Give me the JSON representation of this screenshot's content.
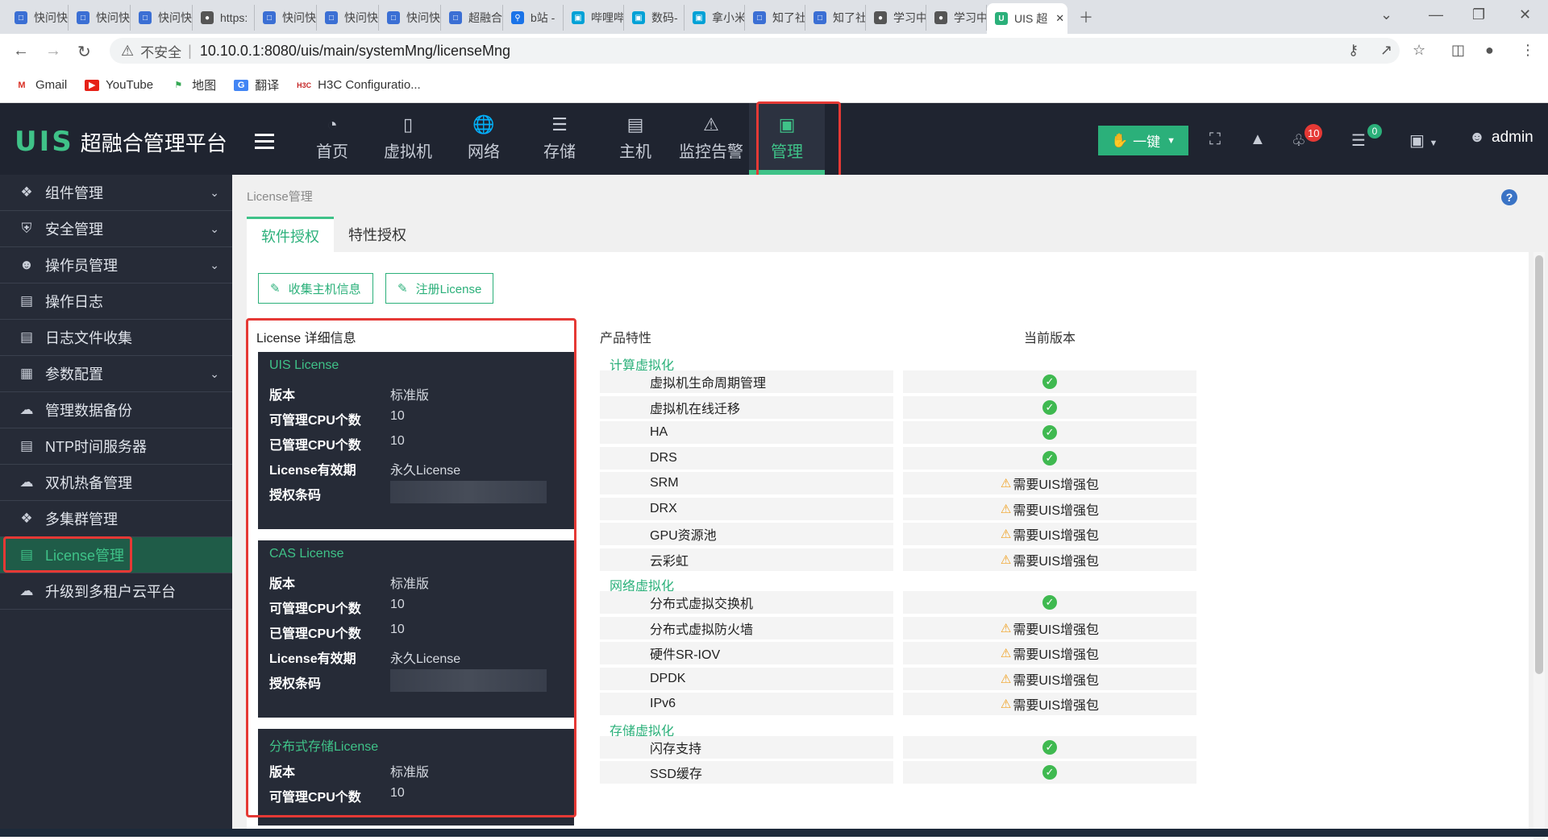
{
  "browser": {
    "tabs": [
      {
        "label": "快问快",
        "icon": "doc-icon"
      },
      {
        "label": "快问快",
        "icon": "doc-icon"
      },
      {
        "label": "快问快",
        "icon": "doc-icon"
      },
      {
        "label": "https:",
        "icon": "globe-icon"
      },
      {
        "label": "快问快",
        "icon": "doc-icon"
      },
      {
        "label": "快问快",
        "icon": "doc-icon"
      },
      {
        "label": "快问快",
        "icon": "doc-icon"
      },
      {
        "label": "超融合",
        "icon": "doc-icon"
      },
      {
        "label": "b站 -",
        "icon": "search-icon"
      },
      {
        "label": "哔哩哔",
        "icon": "bilibili-icon"
      },
      {
        "label": "数码-",
        "icon": "bilibili-icon"
      },
      {
        "label": "拿小米",
        "icon": "bilibili-icon"
      },
      {
        "label": "知了社",
        "icon": "doc-icon"
      },
      {
        "label": "知了社",
        "icon": "doc-icon"
      },
      {
        "label": "学习中",
        "icon": "globe-icon"
      },
      {
        "label": "学习中",
        "icon": "globe-icon"
      },
      {
        "label": "UIS 超",
        "icon": "uis-icon"
      }
    ],
    "address": {
      "security_label": "不安全",
      "url": "10.10.0.1:8080/uis/main/systemMng/licenseMng"
    },
    "bookmarks": [
      {
        "label": "Gmail"
      },
      {
        "label": "YouTube"
      },
      {
        "label": "地图"
      },
      {
        "label": "翻译"
      },
      {
        "label": "H3C Configuratio..."
      }
    ]
  },
  "app": {
    "logo_text": "UIS",
    "title": "超融合管理平台",
    "nav": [
      {
        "label": "首页",
        "icon": "dashboard-icon"
      },
      {
        "label": "虚拟机",
        "icon": "vm-icon"
      },
      {
        "label": "网络",
        "icon": "globe-icon"
      },
      {
        "label": "存储",
        "icon": "database-icon"
      },
      {
        "label": "主机",
        "icon": "server-icon"
      },
      {
        "label": "监控告警",
        "icon": "alarm-icon"
      },
      {
        "label": "管理",
        "icon": "monitor-icon",
        "selected": true
      }
    ],
    "onekey_label": "一键",
    "alarm_count": "10",
    "task_count": "0",
    "user": "admin"
  },
  "sidebar": {
    "items": [
      {
        "label": "组件管理",
        "icon": "puzzle-icon",
        "expandable": true
      },
      {
        "label": "安全管理",
        "icon": "shield-icon",
        "expandable": true
      },
      {
        "label": "操作员管理",
        "icon": "user-icon",
        "expandable": true
      },
      {
        "label": "操作日志",
        "icon": "log-icon",
        "expandable": false
      },
      {
        "label": "日志文件收集",
        "icon": "file-icon",
        "expandable": false
      },
      {
        "label": "参数配置",
        "icon": "config-icon",
        "expandable": true
      },
      {
        "label": "管理数据备份",
        "icon": "backup-icon",
        "expandable": false
      },
      {
        "label": "NTP时间服务器",
        "icon": "clock-icon",
        "expandable": false
      },
      {
        "label": "双机热备管理",
        "icon": "cloud-icon",
        "expandable": false
      },
      {
        "label": "多集群管理",
        "icon": "cluster-icon",
        "expandable": false
      },
      {
        "label": "License管理",
        "icon": "license-icon",
        "expandable": false,
        "active": true
      },
      {
        "label": "升级到多租户云平台",
        "icon": "upgrade-icon",
        "expandable": false
      }
    ]
  },
  "content": {
    "breadcrumb": "License管理",
    "tabs": [
      {
        "label": "软件授权",
        "active": true
      },
      {
        "label": "特性授权",
        "active": false
      }
    ],
    "buttons": {
      "collect": "收集主机信息",
      "register": "注册License"
    },
    "license_title": "License 详细信息",
    "licenses": [
      {
        "name": "UIS License",
        "rows": [
          {
            "k": "版本",
            "v": "标准版"
          },
          {
            "k": "可管理CPU个数",
            "v": "10"
          },
          {
            "k": "已管理CPU个数",
            "v": "10"
          },
          {
            "k": "License有效期",
            "v": "永久License"
          },
          {
            "k": "授权条码",
            "v": ""
          }
        ]
      },
      {
        "name": "CAS License",
        "rows": [
          {
            "k": "版本",
            "v": "标准版"
          },
          {
            "k": "可管理CPU个数",
            "v": "10"
          },
          {
            "k": "已管理CPU个数",
            "v": "10"
          },
          {
            "k": "License有效期",
            "v": "永久License"
          },
          {
            "k": "授权条码",
            "v": ""
          }
        ]
      },
      {
        "name": "分布式存储License",
        "rows": [
          {
            "k": "版本",
            "v": "标准版"
          },
          {
            "k": "可管理CPU个数",
            "v": "10"
          }
        ]
      }
    ],
    "features_header": {
      "name": "产品特性",
      "version": "当前版本"
    },
    "feature_groups": [
      {
        "category": "计算虚拟化",
        "items": [
          {
            "name": "虚拟机生命周期管理",
            "status": "ok",
            "text": ""
          },
          {
            "name": "虚拟机在线迁移",
            "status": "ok",
            "text": ""
          },
          {
            "name": "HA",
            "status": "ok",
            "text": ""
          },
          {
            "name": "DRS",
            "status": "ok",
            "text": ""
          },
          {
            "name": "SRM",
            "status": "warn",
            "text": "需要UIS增强包"
          },
          {
            "name": "DRX",
            "status": "warn",
            "text": "需要UIS增强包"
          },
          {
            "name": "GPU资源池",
            "status": "warn",
            "text": "需要UIS增强包"
          },
          {
            "name": "云彩虹",
            "status": "warn",
            "text": "需要UIS增强包"
          }
        ]
      },
      {
        "category": "网络虚拟化",
        "items": [
          {
            "name": "分布式虚拟交换机",
            "status": "ok",
            "text": ""
          },
          {
            "name": "分布式虚拟防火墙",
            "status": "warn",
            "text": "需要UIS增强包"
          },
          {
            "name": "硬件SR-IOV",
            "status": "warn",
            "text": "需要UIS增强包"
          },
          {
            "name": "DPDK",
            "status": "warn",
            "text": "需要UIS增强包"
          },
          {
            "name": "IPv6",
            "status": "warn",
            "text": "需要UIS增强包"
          }
        ]
      },
      {
        "category": "存储虚拟化",
        "items": [
          {
            "name": "闪存支持",
            "status": "ok",
            "text": ""
          },
          {
            "name": "SSD缓存",
            "status": "ok",
            "text": ""
          }
        ]
      }
    ]
  }
}
